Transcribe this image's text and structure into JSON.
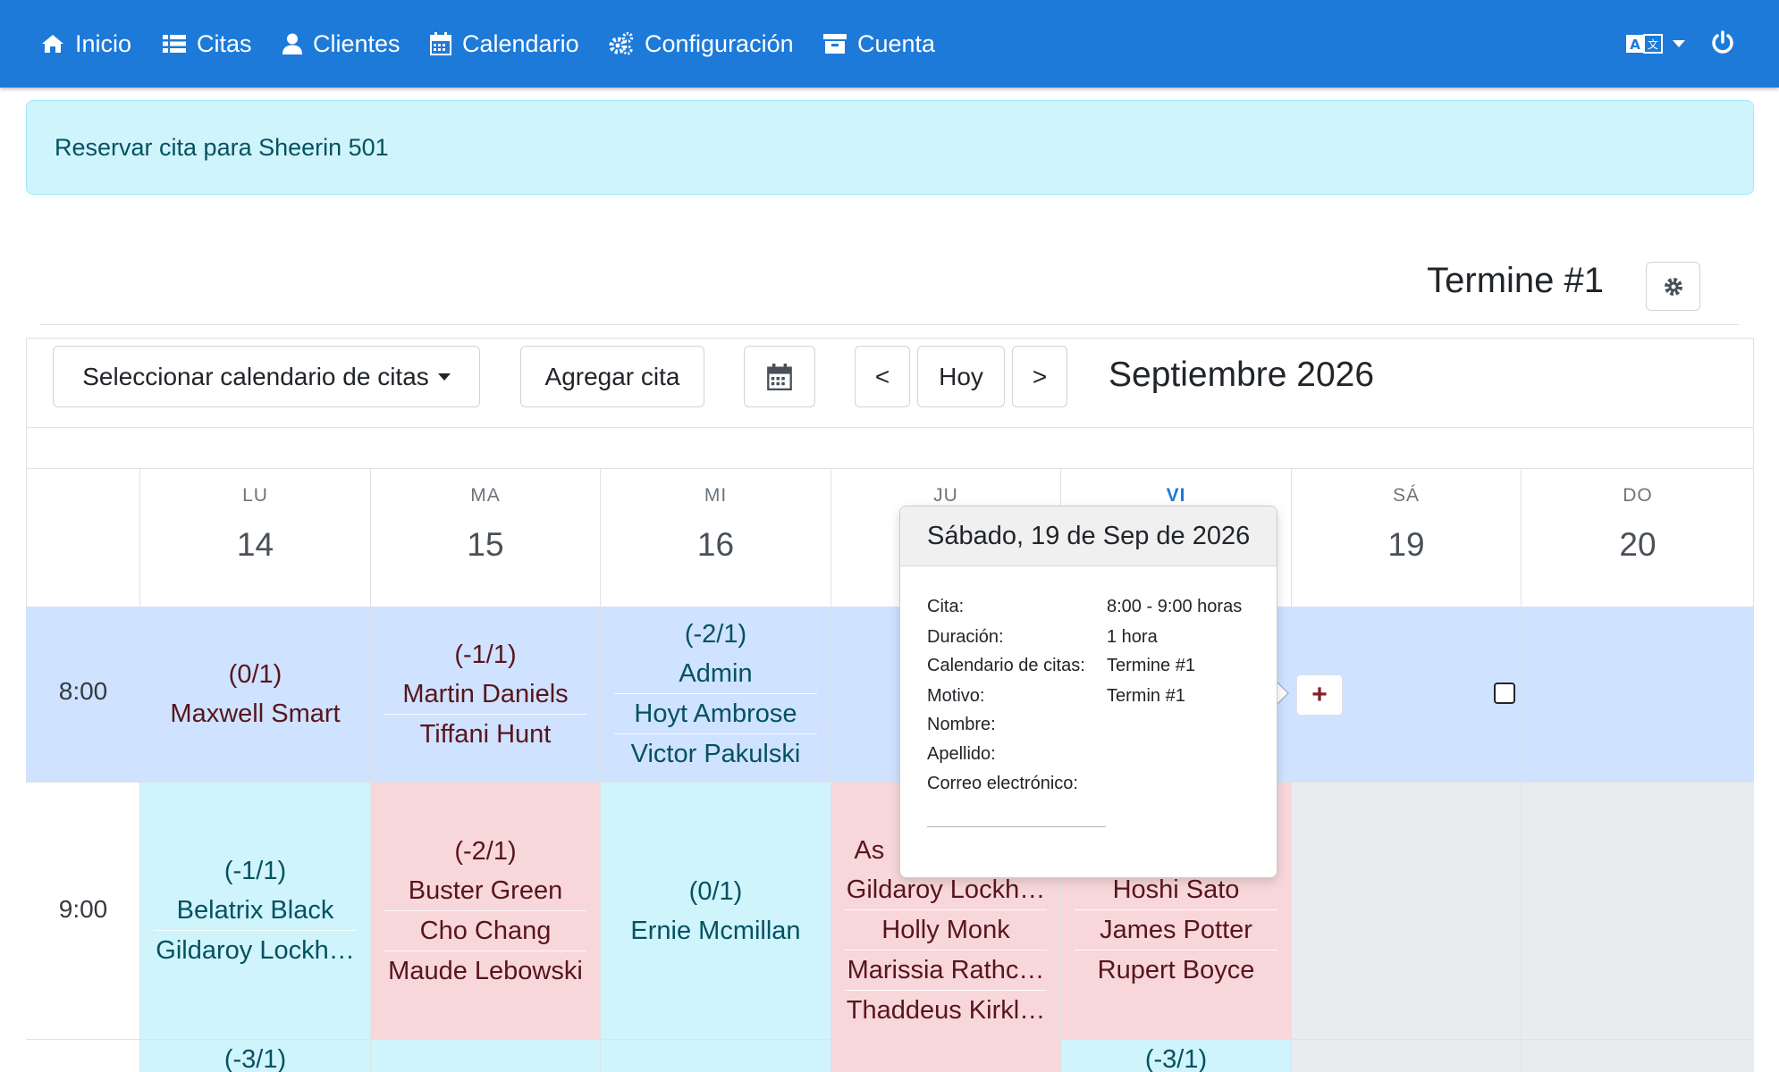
{
  "nav": {
    "items": [
      {
        "label": "Inicio",
        "icon": "home-icon"
      },
      {
        "label": "Citas",
        "icon": "list-icon"
      },
      {
        "label": "Clientes",
        "icon": "user-icon"
      },
      {
        "label": "Calendario",
        "icon": "calendar-icon"
      },
      {
        "label": "Configuración",
        "icon": "cogs-icon"
      },
      {
        "label": "Cuenta",
        "icon": "archive-icon"
      }
    ],
    "colors": {
      "bar": "#1d7ad9",
      "text": "#ffffff"
    }
  },
  "alert": {
    "text": "Reservar cita para Sheerin 501"
  },
  "calendar": {
    "title": "Termine #1",
    "select_label": "Seleccionar calendario de citas",
    "add_label": "Agregar cita",
    "prev_label": "<",
    "today_label": "Hoy",
    "next_label": ">",
    "month": "Septiembre 2026",
    "days": [
      {
        "dow": "LU",
        "num": "14"
      },
      {
        "dow": "MA",
        "num": "15"
      },
      {
        "dow": "MI",
        "num": "16"
      },
      {
        "dow": "JU",
        "num": ""
      },
      {
        "dow": "VI",
        "num": ""
      },
      {
        "dow": "SÁ",
        "num": "19"
      },
      {
        "dow": "DO",
        "num": "20"
      }
    ],
    "times": [
      "8:00",
      "9:00"
    ],
    "row8": {
      "lu": {
        "count": "(0/1)",
        "names": [
          "Maxwell Smart"
        ]
      },
      "ma": {
        "count": "(-1/1)",
        "names": [
          "Martin Daniels",
          "Tiffani Hunt"
        ]
      },
      "mi": {
        "count": "(-2/1)",
        "names": [
          "Admin",
          "Hoyt Ambrose",
          "Victor Pakulski"
        ]
      }
    },
    "row9": {
      "lu": {
        "count": "(-1/1)",
        "names": [
          "Belatrix Black",
          "Gildaroy Lockh…"
        ]
      },
      "ma": {
        "count": "(-2/1)",
        "names": [
          "Buster Green",
          "Cho Chang",
          "Maude Lebowski"
        ]
      },
      "mi": {
        "count": "(0/1)",
        "names": [
          "Ernie Mcmillan"
        ]
      },
      "ju": {
        "partial": "As",
        "names": [
          "Gildaroy Lockh…",
          "Holly Monk",
          "Marissia Rathc…",
          "Thaddeus Kirkl…"
        ]
      },
      "vi": {
        "names": [
          "Hoshi Sato",
          "James Potter",
          "Rupert Boyce"
        ]
      }
    },
    "row10": {
      "lu": {
        "count": "(-3/1)"
      },
      "vi": {
        "count": "(-3/1)"
      }
    }
  },
  "popover": {
    "title": "Sábado, 19 de Sep de 2026",
    "rows": [
      {
        "label": "Cita:",
        "value": "8:00 - 9:00 horas"
      },
      {
        "label": "Duración:",
        "value": "1 hora"
      },
      {
        "label": "Calendario de citas:",
        "value": "Termine #1"
      },
      {
        "label": "Motivo:",
        "value": "Termin #1"
      },
      {
        "label": "Nombre:",
        "value": ""
      },
      {
        "label": "Apellido:",
        "value": ""
      },
      {
        "label": "Correo electrónico:",
        "value": ""
      }
    ]
  },
  "plus_label": "+"
}
